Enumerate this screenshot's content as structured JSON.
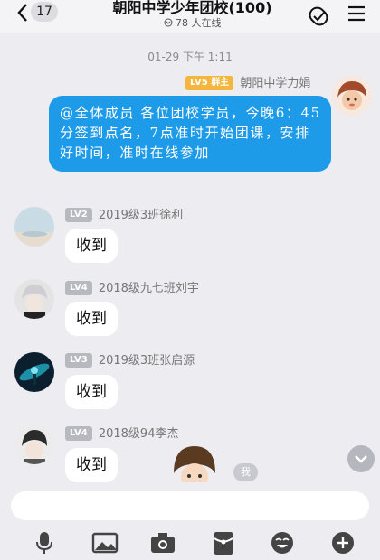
{
  "header": {
    "unread_count": "17",
    "title": "朝阳中学少年团校(100)",
    "online": "78 人在线"
  },
  "timestamp": "01-29 下午 1:11",
  "messages": [
    {
      "level": "LV5",
      "role": "群主",
      "sender": "朝阳中学力娟",
      "text": "@全体成员 各位团校学员，今晚6：45分签到点名，7点准时开始团课，安排好时间，准时在线参加",
      "side": "right"
    },
    {
      "level": "LV2",
      "sender": "2019级3班徐利",
      "text": "收到",
      "side": "left"
    },
    {
      "level": "LV4",
      "sender": "2018级九七班刘宇",
      "text": "收到",
      "side": "left"
    },
    {
      "level": "LV3",
      "sender": "2019级3班张启源",
      "text": "收到",
      "side": "left"
    },
    {
      "level": "LV4",
      "sender": "2018级94李杰",
      "text": "收到",
      "side": "left"
    }
  ],
  "me_label": "我",
  "input": {
    "placeholder": ""
  },
  "toolbar": [
    "mic-icon",
    "image-icon",
    "camera-icon",
    "red-packet-icon",
    "emoji-icon",
    "plus-icon"
  ],
  "colors": {
    "bubble_blue": "#1e9be8",
    "level_gold": "#f4b63f",
    "level_gray": "#b8b8bf",
    "background": "#ececf1"
  }
}
